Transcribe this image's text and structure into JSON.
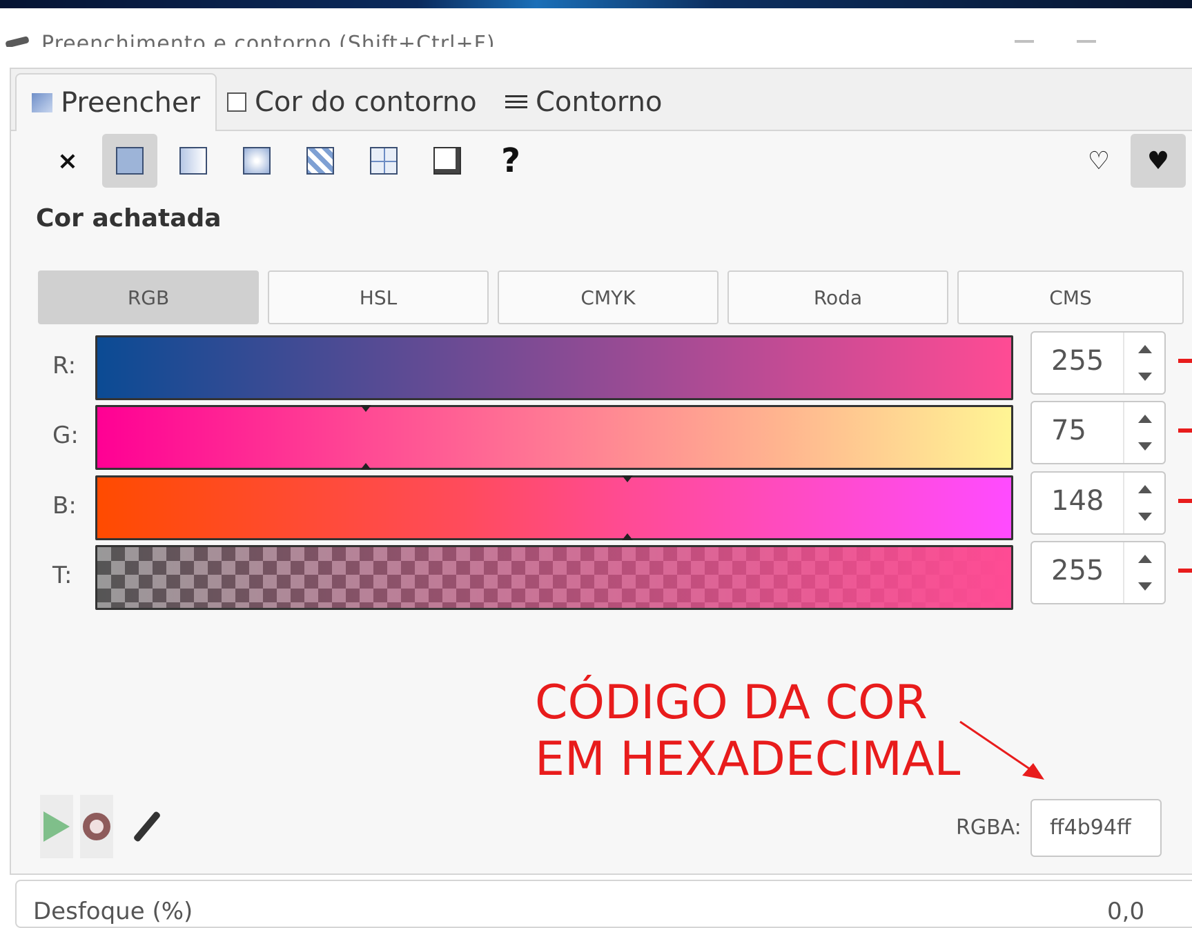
{
  "window": {
    "title": "Preenchimento e contorno (Shift+Ctrl+F)"
  },
  "tabs": [
    {
      "label": "Preencher",
      "icon": "fill-tab-icon",
      "active": true
    },
    {
      "label": "Cor do contorno",
      "icon": "stroke-paint-tab-icon",
      "active": false
    },
    {
      "label": "Contorno",
      "icon": "stroke-style-tab-icon",
      "active": false
    }
  ],
  "paint_types": [
    {
      "name": "no-paint",
      "icon": "x-icon",
      "glyph": "×",
      "selected": false
    },
    {
      "name": "flat-color",
      "icon": "flat-color-icon",
      "selected": true
    },
    {
      "name": "linear-gradient",
      "icon": "linear-gradient-icon",
      "selected": false
    },
    {
      "name": "radial-gradient",
      "icon": "radial-gradient-icon",
      "selected": false
    },
    {
      "name": "mesh-gradient",
      "icon": "mesh-gradient-icon",
      "selected": false
    },
    {
      "name": "pattern",
      "icon": "pattern-icon",
      "selected": false
    },
    {
      "name": "swatch",
      "icon": "swatch-icon",
      "selected": false
    },
    {
      "name": "unset",
      "icon": "question-icon",
      "glyph": "?",
      "selected": false
    }
  ],
  "fill_rules": [
    {
      "name": "evenodd",
      "icon": "fill-rule-evenodd-icon",
      "glyph": "♡",
      "selected": false
    },
    {
      "name": "nonzero",
      "icon": "fill-rule-nonzero-icon",
      "glyph": "♥",
      "selected": true
    }
  ],
  "section_title": "Cor achatada",
  "color_modes": [
    {
      "label": "RGB",
      "active": true
    },
    {
      "label": "HSL",
      "active": false
    },
    {
      "label": "CMYK",
      "active": false
    },
    {
      "label": "Roda",
      "active": false
    },
    {
      "label": "CMS",
      "active": false
    }
  ],
  "channels": [
    {
      "label": "R:",
      "value": "255",
      "fraction": 1.0
    },
    {
      "label": "G:",
      "value": "75",
      "fraction": 0.294
    },
    {
      "label": "B:",
      "value": "148",
      "fraction": 0.58
    },
    {
      "label": "T:",
      "value": "255",
      "fraction": 1.0
    }
  ],
  "annotation": {
    "line1": "CÓDIGO DA COR",
    "line2": "EM HEXADECIMAL",
    "color": "#e81c1c"
  },
  "rgba": {
    "label": "RGBA:",
    "value": "ff4b94ff"
  },
  "blur": {
    "label": "Desfoque (%)",
    "value": "0,0"
  },
  "colors": {
    "current": "#ff4b94",
    "accent_annotation": "#e81c1c"
  }
}
